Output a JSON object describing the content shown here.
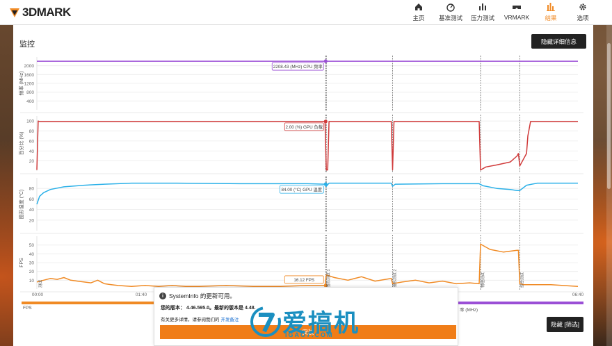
{
  "app": {
    "logo_text": "3DMARK"
  },
  "nav": {
    "items": [
      {
        "label": "主页",
        "icon": "home-icon"
      },
      {
        "label": "基准测试",
        "icon": "gauge-icon"
      },
      {
        "label": "压力测试",
        "icon": "bar-chart-icon"
      },
      {
        "label": "VRMARK",
        "icon": "vr-headset-icon"
      },
      {
        "label": "结果",
        "icon": "results-icon",
        "active": true
      },
      {
        "label": "选项",
        "icon": "gear-icon"
      }
    ],
    "active_color": "#f08a24"
  },
  "monitor": {
    "title": "监控",
    "hide_details_button": "隐藏详细信息",
    "hide_markers_button": "隐藏 [筛选]"
  },
  "chart_data": [
    {
      "type": "line",
      "ylabel": "频率 (MHz)",
      "yticks": [
        2000,
        1600,
        1200,
        800,
        400
      ],
      "ylim": [
        0,
        2400
      ],
      "color": "#9b4fd6",
      "series": [
        {
          "name": "CPU 频率",
          "x": [
            0,
            400
          ],
          "values": [
            2208.43,
            2208.43
          ]
        }
      ],
      "tooltip": "2208.43 (MHz) CPU 频率"
    },
    {
      "type": "line",
      "ylabel": "百分比 (%)",
      "yticks": [
        100,
        80,
        60,
        40,
        20
      ],
      "ylim": [
        0,
        110
      ],
      "color": "#d03a3a",
      "series": [
        {
          "name": "GPU 负载",
          "x": [
            0,
            1,
            2,
            3,
            213,
            214,
            215,
            216,
            262,
            263,
            264,
            327,
            328,
            332,
            340,
            350,
            355,
            356,
            357,
            362,
            363,
            365,
            400
          ],
          "values": [
            2,
            100,
            99,
            99,
            99,
            2,
            2,
            99,
            99,
            2,
            99,
            99,
            2,
            8,
            12,
            18,
            30,
            35,
            10,
            35,
            70,
            99,
            99
          ]
        }
      ],
      "tooltip": "2.00 (%) GPU 负载"
    },
    {
      "type": "line",
      "ylabel": "图形温度 (°C)",
      "yticks": [
        80,
        60,
        40,
        20
      ],
      "ylim": [
        0,
        100
      ],
      "color": "#2ab0e8",
      "series": [
        {
          "name": "GPU 温度",
          "x": [
            0,
            2,
            5,
            10,
            20,
            35,
            50,
            70,
            100,
            150,
            200,
            213,
            214,
            216,
            230,
            262,
            263,
            265,
            300,
            327,
            330,
            340,
            350,
            355,
            357,
            362,
            370,
            400
          ],
          "values": [
            50,
            65,
            72,
            78,
            83,
            86,
            88,
            90,
            90,
            89,
            89,
            88,
            84,
            90,
            90,
            90,
            84,
            88,
            89,
            89,
            85,
            80,
            78,
            76,
            76,
            86,
            90,
            90
          ]
        }
      ],
      "tooltip": "84.00 (°C) GPU 温度"
    },
    {
      "type": "line",
      "ylabel": "FPS",
      "yticks": [
        50,
        40,
        30,
        20,
        10
      ],
      "ylim": [
        0,
        60
      ],
      "color": "#f08a24",
      "series": [
        {
          "name": "FPS",
          "x": [
            0,
            5,
            10,
            15,
            20,
            25,
            30,
            35,
            40,
            45,
            50,
            55,
            60,
            70,
            80,
            90,
            100,
            110,
            120,
            140,
            160,
            180,
            200,
            213,
            214,
            220,
            230,
            240,
            250,
            262,
            263,
            270,
            280,
            290,
            300,
            310,
            320,
            327,
            328,
            335,
            345,
            355,
            356,
            357,
            360,
            380,
            400
          ],
          "values": [
            8,
            10,
            12,
            11,
            13,
            10,
            9,
            8,
            7,
            10,
            6,
            5,
            4,
            3,
            4,
            3,
            4,
            3,
            3,
            4,
            3,
            3,
            4,
            4,
            16,
            13,
            10,
            14,
            9,
            12,
            6,
            8,
            10,
            7,
            9,
            6,
            7,
            6,
            51,
            45,
            42,
            44,
            44,
            6,
            5,
            5,
            3
          ]
        }
      ],
      "tooltip": "16.12 FPS",
      "markers": [
        "测试",
        "图形测试 1",
        "图形测试 2",
        "物理测试",
        "综合测试"
      ]
    }
  ],
  "x_axis": {
    "ticks": [
      "00:00",
      "01:40",
      "06:40"
    ]
  },
  "legend": {
    "left": "FPS",
    "right": "率 (MHz)"
  },
  "notification": {
    "title": "SystemInfo 的更新可用。",
    "versions": "您的版本：  4.46.595.0。最新的版本是 4.48.",
    "more_info": "有关更多详情，请参阅我们的",
    "more_info_link": "开发备注",
    "install_button": "安装"
  },
  "watermark": {
    "text": "爱搞机",
    "url": "IGAO7.COM"
  }
}
